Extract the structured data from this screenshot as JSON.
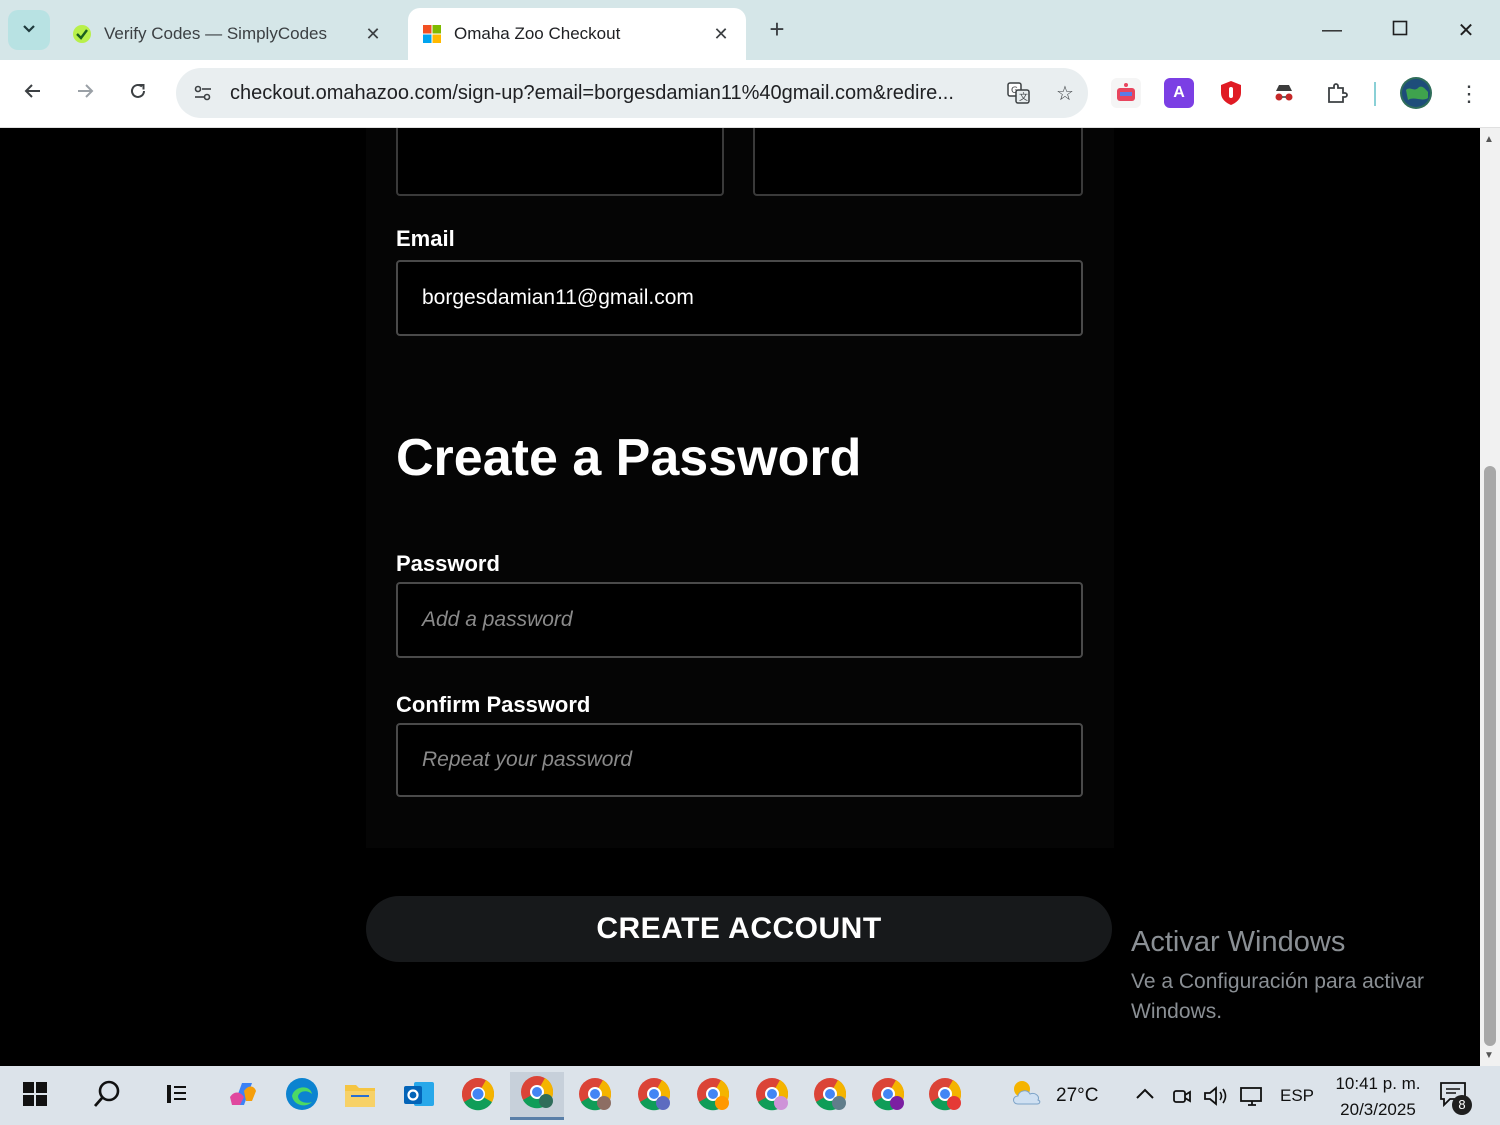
{
  "browser": {
    "tabs": [
      {
        "title": "Verify Codes — SimplyCodes",
        "active": false,
        "favicon": "simplycodes-icon"
      },
      {
        "title": "Omaha Zoo Checkout",
        "active": true,
        "favicon": "microsoft-icon"
      }
    ],
    "url": "checkout.omahazoo.com/sign-up?email=borgesdamian11%40gmail.com&redire..."
  },
  "form": {
    "email_label": "Email",
    "email_value": "borgesdamian11@gmail.com",
    "section_title": "Create a Password",
    "password_label": "Password",
    "password_placeholder": "Add a password",
    "confirm_label": "Confirm Password",
    "confirm_placeholder": "Repeat your password",
    "submit_label": "CREATE ACCOUNT"
  },
  "watermark": {
    "title": "Activar Windows",
    "subtitle": "Ve a Configuración para activar Windows."
  },
  "taskbar": {
    "weather": "27°C",
    "language": "ESP",
    "time": "10:41 p. m.",
    "date": "20/3/2025",
    "notifications": "8"
  },
  "colors": {
    "page_bg": "#000000",
    "button_bg": "#17191b",
    "tab_strip": "#d5e6e8"
  }
}
